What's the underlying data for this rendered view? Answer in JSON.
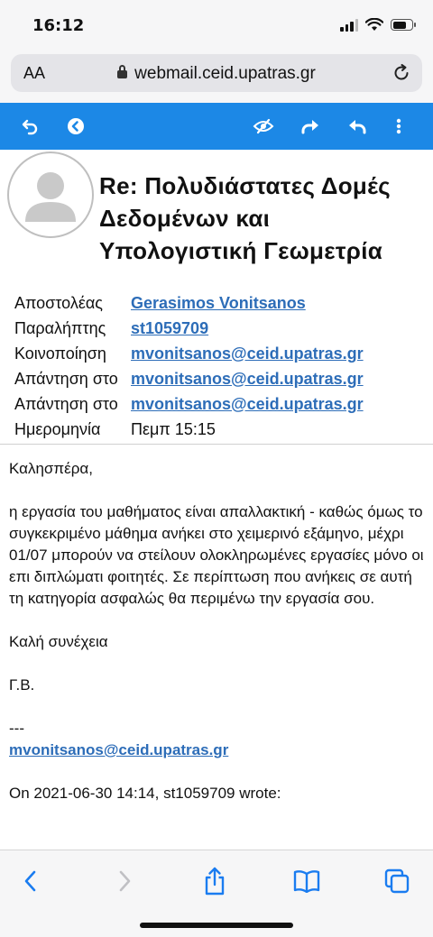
{
  "status": {
    "time": "16:12",
    "battery_level": 0.7
  },
  "browser": {
    "text_size_label": "AA",
    "url": "webmail.ceid.upatras.gr"
  },
  "toolbar": {
    "icons": [
      "undo-icon",
      "back-circle-icon",
      "hide-eye-icon",
      "forward-icon",
      "reply-icon",
      "more-vertical-icon"
    ]
  },
  "email": {
    "subject": "Re: Πολυδιάστατες Δομές Δεδομένων και Υπολογιστική Γεωμετρία",
    "meta": [
      {
        "label": "Αποστολέας",
        "value": "Gerasimos Vonitsanos"
      },
      {
        "label": "Παραλήπτης",
        "value": "st1059709"
      },
      {
        "label": "Κοινοποίηση",
        "value": "mvonitsanos@ceid.upatras.gr"
      },
      {
        "label": "Απάντηση στο",
        "value": "mvonitsanos@ceid.upatras.gr"
      },
      {
        "label": "Απάντηση στο",
        "value": "mvonitsanos@ceid.upatras.gr"
      },
      {
        "label": "Ημερομηνία",
        "value": "Πεμπ 15:15"
      }
    ],
    "body": {
      "greeting": "Καλησπέρα,",
      "paragraph": "η εργασία του μαθήματος είναι απαλλακτική - καθώς όμως το συγκεκριμένο μάθημα ανήκει στο χειμερινό εξάμηνο, μέχρι 01/07 μπορούν να στείλουν ολοκληρωμένες εργασίες μόνο οι επι διπλώματι φοιτητές. Σε περίπτωση που ανήκεις σε αυτή τη κατηγορία ασφαλώς θα περιμένω την εργασία σου.",
      "closing": "Καλή συνέχεια",
      "initials": "Γ.Β.",
      "separator": "---",
      "signature_email": "mvonitsanos@ceid.upatras.gr",
      "quote_header": "On 2021-06-30 14:14, st1059709 wrote:"
    }
  },
  "colors": {
    "accent": "#1c88e6",
    "link": "#2d6db8",
    "ios_blue": "#1a7cf0"
  }
}
